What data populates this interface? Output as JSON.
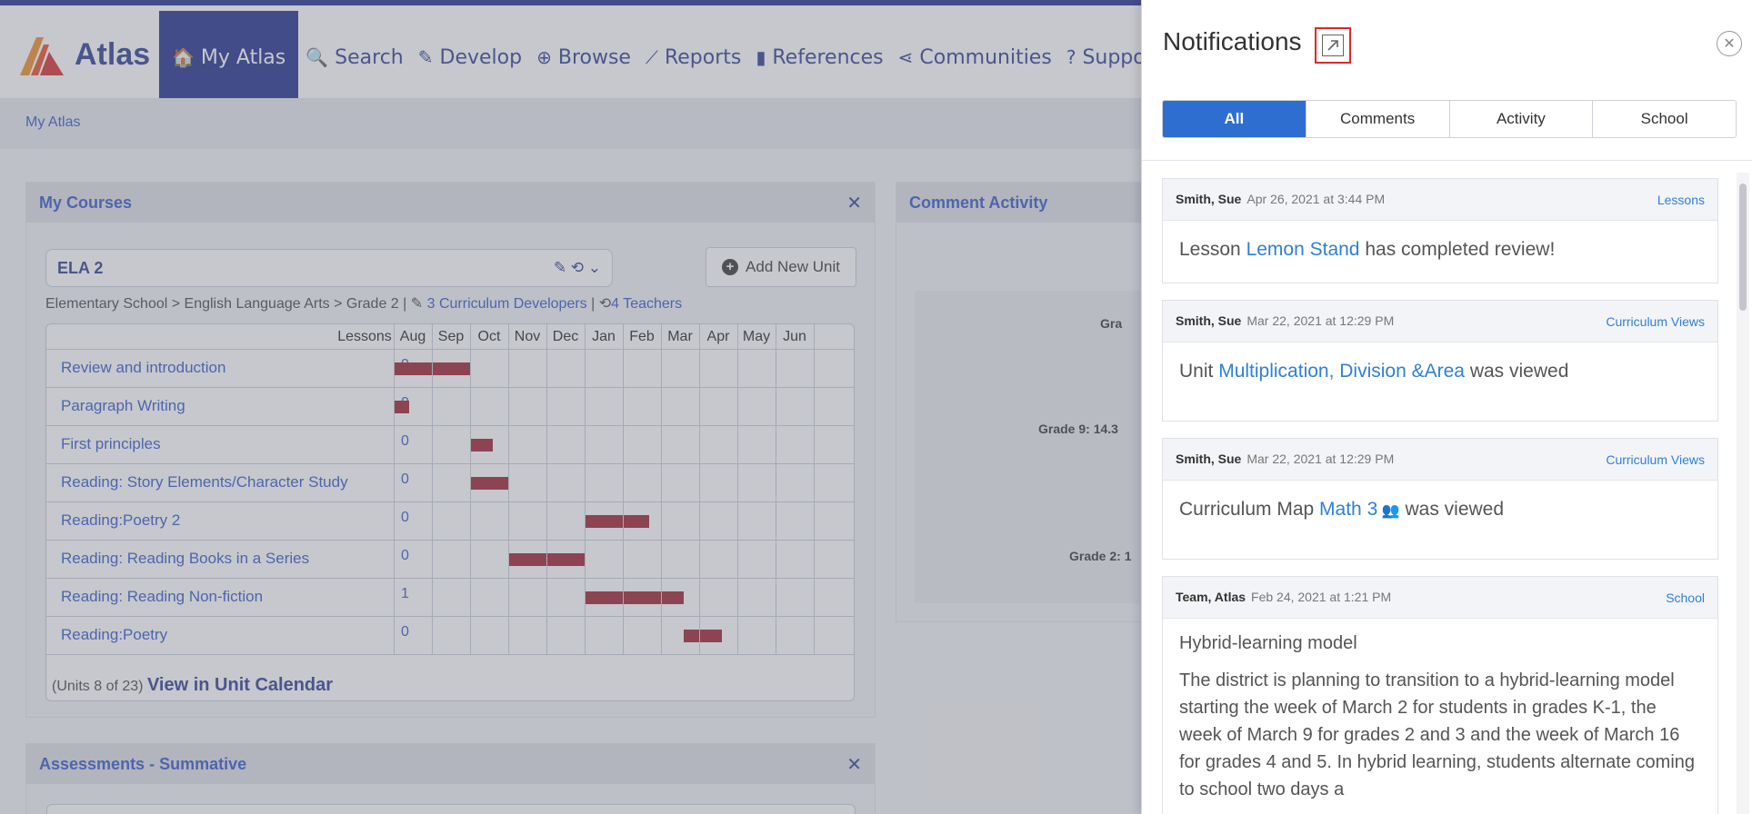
{
  "app": {
    "name": "Atlas",
    "brand_color": "#1a2a8a",
    "accent_color": "#2f55c8"
  },
  "nav": {
    "items": [
      {
        "label": "My Atlas",
        "icon": "home-icon",
        "glyph": "🏠",
        "active": true
      },
      {
        "label": "Search",
        "icon": "search-icon",
        "glyph": "🔍"
      },
      {
        "label": "Develop",
        "icon": "edit-icon",
        "glyph": "✎"
      },
      {
        "label": "Browse",
        "icon": "globe-icon",
        "glyph": "⊕"
      },
      {
        "label": "Reports",
        "icon": "chart-icon",
        "glyph": "⟋"
      },
      {
        "label": "References",
        "icon": "book-icon",
        "glyph": "▮"
      },
      {
        "label": "Communities",
        "icon": "share-icon",
        "glyph": "⋖"
      },
      {
        "label": "Suppo",
        "icon": "help-icon",
        "glyph": "?"
      }
    ]
  },
  "breadcrumb": {
    "label": "My Atlas"
  },
  "my_courses": {
    "title": "My Courses",
    "course_name": "ELA 2",
    "course_tools": "✎ ⟲ ⌄",
    "add_unit_label": "Add New Unit",
    "meta_path": "Elementary School > English Language Arts > Grade 2 |",
    "developers_link": "3 Curriculum Developers",
    "meta_sep": "|",
    "teachers_link": "4 Teachers",
    "columns": [
      "Lessons",
      "Aug",
      "Sep",
      "Oct",
      "Nov",
      "Dec",
      "Jan",
      "Feb",
      "Mar",
      "Apr",
      "May",
      "Jun"
    ],
    "units": [
      {
        "name": "Review and introduction",
        "lessons": "0",
        "start": 0,
        "end": 2
      },
      {
        "name": "Paragraph Writing",
        "lessons": "0",
        "start": 0,
        "end": 0.4
      },
      {
        "name": "First principles",
        "lessons": "0",
        "start": 2,
        "end": 2.6
      },
      {
        "name": "Reading: Story Elements/Character Study",
        "lessons": "0",
        "start": 2,
        "end": 3
      },
      {
        "name": "Reading:Poetry 2",
        "lessons": "0",
        "start": 5,
        "end": 6.7
      },
      {
        "name": "Reading: Reading Books in a Series",
        "lessons": "0",
        "start": 3,
        "end": 5
      },
      {
        "name": "Reading: Reading Non-fiction",
        "lessons": "1",
        "start": 5,
        "end": 7.6
      },
      {
        "name": "Reading:Poetry",
        "lessons": "0",
        "start": 7.6,
        "end": 8.6
      }
    ],
    "units_count": "(Units 8 of 23)",
    "calendar_link": "View in Unit Calendar"
  },
  "assessments": {
    "title": "Assessments - Summative"
  },
  "comment_activity": {
    "title": "Comment Activity",
    "labels": [
      "Gra",
      "Grade 9: 14.3",
      "Grade 2: 1"
    ]
  },
  "notifications": {
    "title": "Notifications",
    "tabs": [
      "All",
      "Comments",
      "Activity",
      "School"
    ],
    "active_tab": "All",
    "items": [
      {
        "author": "Smith, Sue",
        "date": "Apr 26, 2021 at 3:44 PM",
        "category": "Lessons",
        "prefix": "Lesson",
        "link": "Lemon Stand",
        "suffix": "has completed review!"
      },
      {
        "author": "Smith, Sue",
        "date": "Mar 22, 2021 at 12:29 PM",
        "category": "Curriculum Views",
        "prefix": "Unit",
        "link": "Multiplication, Division &Area",
        "suffix": "was viewed"
      },
      {
        "author": "Smith, Sue",
        "date": "Mar 22, 2021 at 12:29 PM",
        "category": "Curriculum Views",
        "prefix": "Curriculum Map",
        "link": "Math 3",
        "suffix": "was viewed"
      },
      {
        "author": "Team, Atlas",
        "date": "Feb 24, 2021 at 1:21 PM",
        "category": "School",
        "subject": "Hybrid-learning model",
        "body": "The district is planning to transition to a hybrid-learning model starting the week of March 2 for students in grades K-1, the week of March 9 for grades 2 and 3 and the week of March 16 for grades 4 and 5. In hybrid learning, students alternate coming to school two days a"
      }
    ]
  }
}
